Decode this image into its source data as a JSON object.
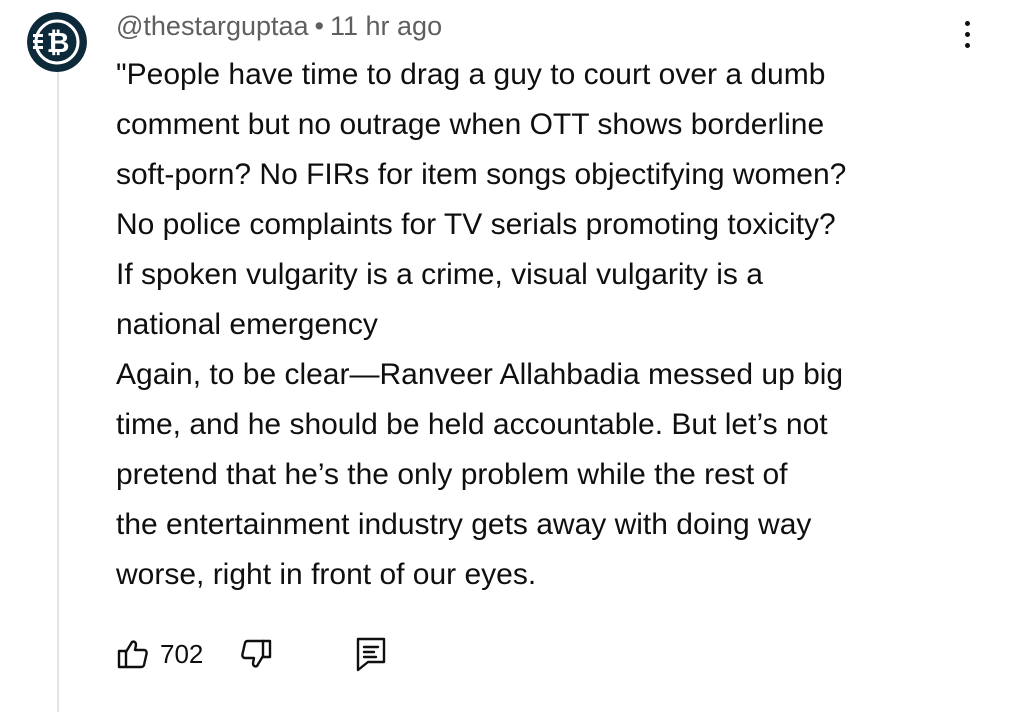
{
  "comment": {
    "author": "@thestarguptaa",
    "separator": "•",
    "timestamp": "11 hr ago",
    "avatar_icon": "crypto-coin-logo",
    "menu_icon": "vertical-ellipsis-icon",
    "lines": [
      "\"People have time to drag a guy to court over a dumb",
      "comment but no outrage when OTT shows borderline",
      "soft-porn? No FIRs for item songs objectifying women?",
      "No police complaints for TV serials promoting toxicity?",
      "If spoken vulgarity is a crime, visual vulgarity is a",
      "national emergency",
      "Again, to be clear—Ranveer Allahbadia messed up big",
      "time, and he should be held accountable. But let’s not",
      "pretend that he’s the only problem while the rest of",
      "the entertainment industry gets away with doing way",
      "worse, right in front of our eyes."
    ],
    "actions": {
      "like_count": "702",
      "like_icon": "thumbs-up-icon",
      "dislike_icon": "thumbs-down-icon",
      "reply_icon": "reply-comment-icon"
    }
  },
  "colors": {
    "text": "#0f0f0f",
    "meta": "#5f5f5f",
    "avatar_bg": "#0d2a3a",
    "thread_line": "#e3e3e3"
  }
}
